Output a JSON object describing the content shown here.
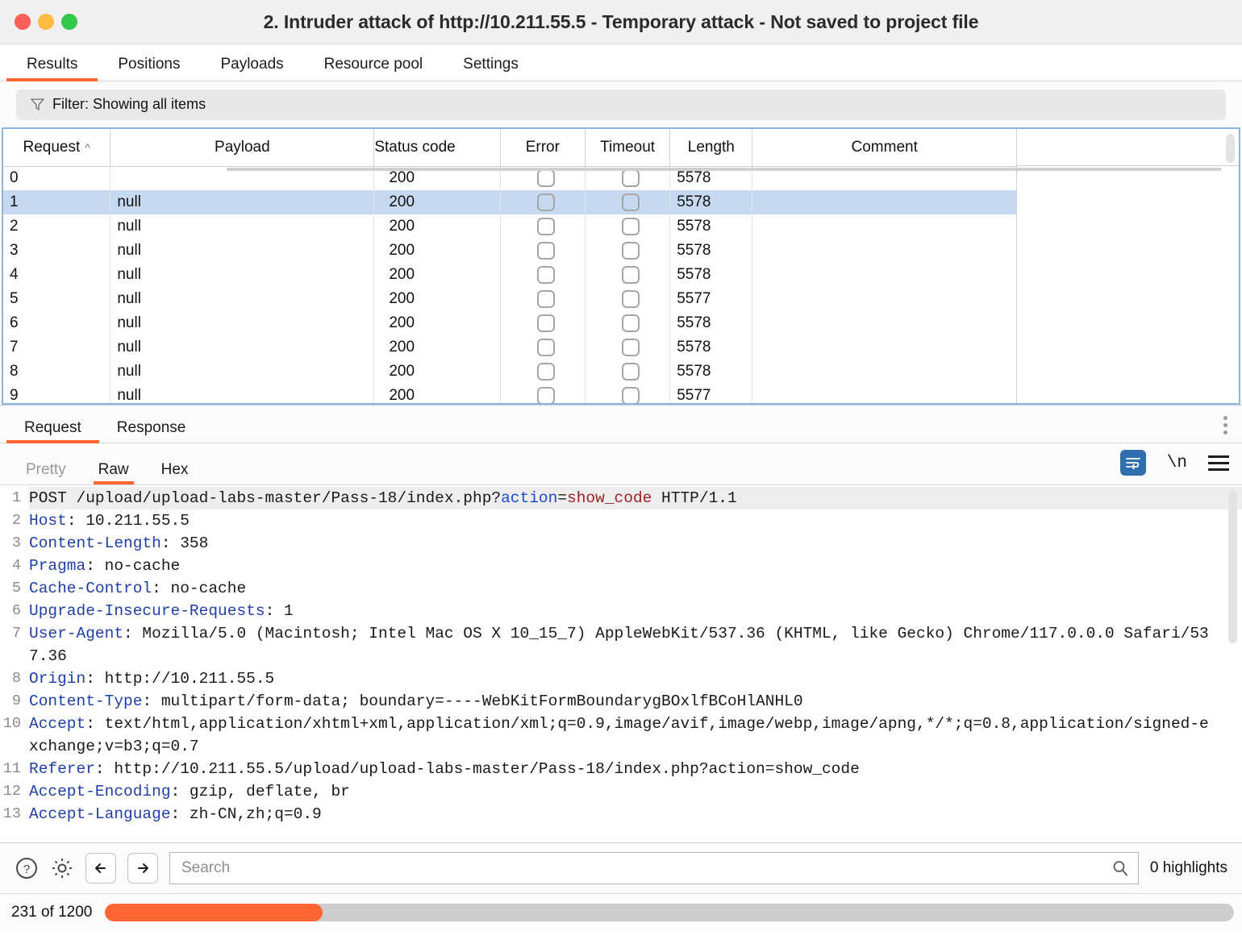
{
  "window": {
    "title": "2. Intruder attack of http://10.211.55.5 - Temporary attack - Not saved to project file",
    "traffic": {
      "close": "close-button",
      "minimize": "minimize-button",
      "zoom": "zoom-button"
    }
  },
  "top_tabs": [
    {
      "label": "Results",
      "active": true
    },
    {
      "label": "Positions",
      "active": false
    },
    {
      "label": "Payloads",
      "active": false
    },
    {
      "label": "Resource pool",
      "active": false
    },
    {
      "label": "Settings",
      "active": false
    }
  ],
  "filter": {
    "label": "Filter: Showing all items",
    "icon": "funnel-icon"
  },
  "results_table": {
    "columns": [
      "Request",
      "Payload",
      "Status code",
      "Error",
      "Timeout",
      "Length",
      "Comment"
    ],
    "sort_column": "Request",
    "sort_direction": "asc",
    "rows": [
      {
        "request": "0",
        "payload": "",
        "status": "200",
        "error": false,
        "timeout": false,
        "length": "5578",
        "comment": "",
        "selected": false
      },
      {
        "request": "1",
        "payload": "null",
        "status": "200",
        "error": false,
        "timeout": false,
        "length": "5578",
        "comment": "",
        "selected": true
      },
      {
        "request": "2",
        "payload": "null",
        "status": "200",
        "error": false,
        "timeout": false,
        "length": "5578",
        "comment": "",
        "selected": false
      },
      {
        "request": "3",
        "payload": "null",
        "status": "200",
        "error": false,
        "timeout": false,
        "length": "5578",
        "comment": "",
        "selected": false
      },
      {
        "request": "4",
        "payload": "null",
        "status": "200",
        "error": false,
        "timeout": false,
        "length": "5578",
        "comment": "",
        "selected": false
      },
      {
        "request": "5",
        "payload": "null",
        "status": "200",
        "error": false,
        "timeout": false,
        "length": "5577",
        "comment": "",
        "selected": false
      },
      {
        "request": "6",
        "payload": "null",
        "status": "200",
        "error": false,
        "timeout": false,
        "length": "5578",
        "comment": "",
        "selected": false
      },
      {
        "request": "7",
        "payload": "null",
        "status": "200",
        "error": false,
        "timeout": false,
        "length": "5578",
        "comment": "",
        "selected": false
      },
      {
        "request": "8",
        "payload": "null",
        "status": "200",
        "error": false,
        "timeout": false,
        "length": "5578",
        "comment": "",
        "selected": false
      },
      {
        "request": "9",
        "payload": "null",
        "status": "200",
        "error": false,
        "timeout": false,
        "length": "5577",
        "comment": "",
        "selected": false
      }
    ]
  },
  "message_tabs": [
    {
      "label": "Request",
      "active": true
    },
    {
      "label": "Response",
      "active": false
    }
  ],
  "view_tabs": [
    {
      "label": "Pretty",
      "active": false,
      "muted": true
    },
    {
      "label": "Raw",
      "active": true,
      "muted": false
    },
    {
      "label": "Hex",
      "active": false,
      "muted": false
    }
  ],
  "view_tools": {
    "wrap_icon": "word-wrap-icon",
    "newline_label": "\\n",
    "menu_icon": "hamburger-menu-icon",
    "kebab_icon": "more-options-icon"
  },
  "request": {
    "lines": [
      {
        "n": "1",
        "method": "POST ",
        "path": "/upload/upload-labs-master/Pass-18/index.php?",
        "param": "action",
        "eq": "=",
        "value": "show_code",
        "proto": " HTTP/1.1"
      },
      {
        "n": "2",
        "header": "Host",
        "value": " 10.211.55.5"
      },
      {
        "n": "3",
        "header": "Content-Length",
        "value": " 358"
      },
      {
        "n": "4",
        "header": "Pragma",
        "value": " no-cache"
      },
      {
        "n": "5",
        "header": "Cache-Control",
        "value": " no-cache"
      },
      {
        "n": "6",
        "header": "Upgrade-Insecure-Requests",
        "value": " 1"
      },
      {
        "n": "7",
        "header": "User-Agent",
        "value": " Mozilla/5.0 (Macintosh; Intel Mac OS X 10_15_7) AppleWebKit/537.36 (KHTML, like Gecko) Chrome/117.0.0.0 Safari/537.36"
      },
      {
        "n": "8",
        "header": "Origin",
        "value": " http://10.211.55.5"
      },
      {
        "n": "9",
        "header": "Content-Type",
        "value": " multipart/form-data; boundary=----WebKitFormBoundarygBOxlfBCoHlANHL0"
      },
      {
        "n": "10",
        "header": "Accept",
        "value": " text/html,application/xhtml+xml,application/xml;q=0.9,image/avif,image/webp,image/apng,*/*;q=0.8,application/signed-exchange;v=b3;q=0.7"
      },
      {
        "n": "11",
        "header": "Referer",
        "value": " http://10.211.55.5/upload/upload-labs-master/Pass-18/index.php?action=show_code"
      },
      {
        "n": "12",
        "header": "Accept-Encoding",
        "value": " gzip, deflate, br"
      },
      {
        "n": "13",
        "header": "Accept-Language",
        "value": " zh-CN,zh;q=0.9"
      }
    ]
  },
  "search": {
    "placeholder": "Search",
    "value": "",
    "highlights": "0 highlights",
    "help_icon": "help-icon",
    "settings_icon": "gear-icon",
    "prev_icon": "arrow-left-icon",
    "next_icon": "arrow-right-icon",
    "search_icon": "search-icon"
  },
  "status": {
    "text": "231 of 1200",
    "progress_percent": 19.25,
    "progress_color": "#ff6633"
  }
}
